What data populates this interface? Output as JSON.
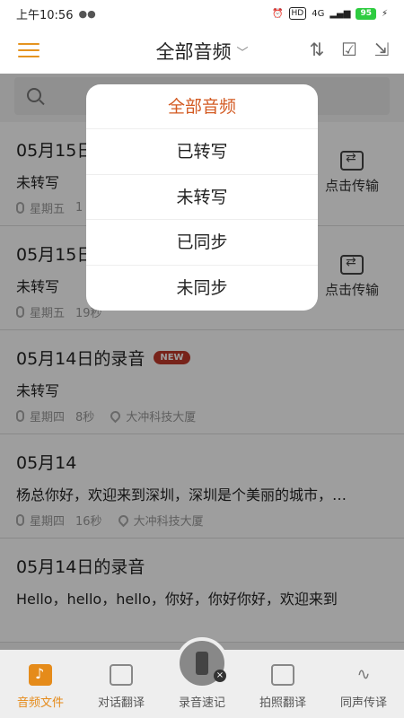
{
  "status": {
    "time": "上午10:56",
    "battery": "95",
    "signal": "4G"
  },
  "header": {
    "title": "全部音频"
  },
  "dropdown": {
    "options": [
      "全部音频",
      "已转写",
      "未转写",
      "已同步",
      "未同步"
    ],
    "selected": "全部音频"
  },
  "list": [
    {
      "title": "05月15日",
      "content": "未转写",
      "day": "星期五",
      "duration": "1",
      "transfer": "点击传输"
    },
    {
      "title": "05月15日",
      "content": "未转写",
      "day": "星期五",
      "duration": "19秒",
      "transfer": "点击传输"
    },
    {
      "title": "05月14日的录音",
      "badge": "NEW",
      "content": "未转写",
      "day": "星期四",
      "duration": "8秒",
      "location": "大冲科技大厦"
    },
    {
      "title": "05月14",
      "content": "杨总你好，欢迎来到深圳，深圳是个美丽的城市，…",
      "day": "星期四",
      "duration": "16秒",
      "location": "大冲科技大厦"
    },
    {
      "title": "05月14日的录音",
      "content": "Hello，hello，hello，你好，你好你好，欢迎来到"
    }
  ],
  "nav": {
    "items": [
      "音频文件",
      "对话翻译",
      "录音速记",
      "拍照翻译",
      "同声传译"
    ],
    "active": "音频文件"
  },
  "colors": {
    "accent": "#e58b1a",
    "selected_option": "#d35a22",
    "badge": "#c0392b"
  }
}
